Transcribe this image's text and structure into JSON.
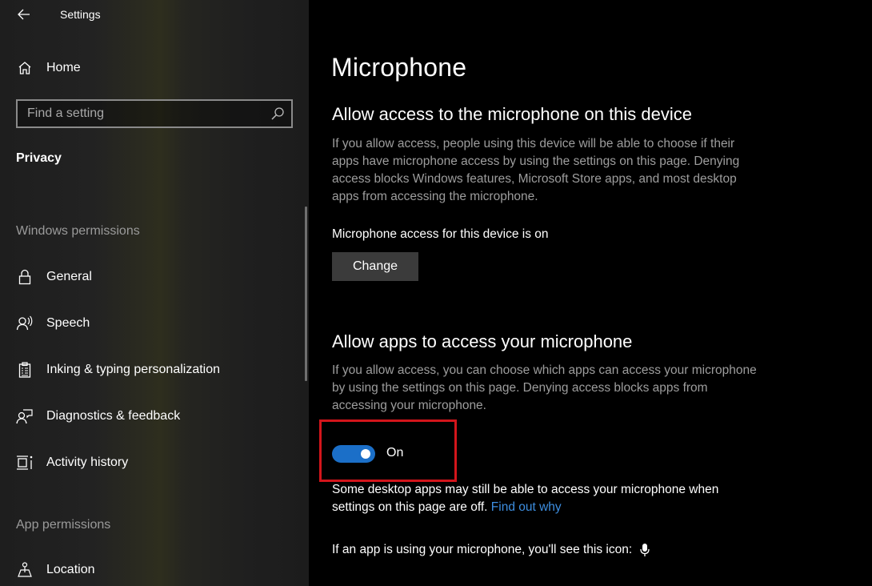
{
  "window": {
    "title": "Settings",
    "back_icon": "back-arrow-icon"
  },
  "sidebar": {
    "home": {
      "label": "Home",
      "icon": "home-icon"
    },
    "search": {
      "placeholder": "Find a setting",
      "value": "",
      "icon": "search-icon"
    },
    "current_section": "Privacy",
    "groups": [
      {
        "header": "Windows permissions",
        "items": [
          {
            "label": "General",
            "icon": "lock-icon"
          },
          {
            "label": "Speech",
            "icon": "speech-icon"
          },
          {
            "label": "Inking & typing personalization",
            "icon": "clipboard-icon"
          },
          {
            "label": "Diagnostics & feedback",
            "icon": "diagnostics-icon"
          },
          {
            "label": "Activity history",
            "icon": "activity-history-icon"
          }
        ]
      },
      {
        "header": "App permissions",
        "items": [
          {
            "label": "Location",
            "icon": "location-icon"
          }
        ]
      }
    ]
  },
  "main": {
    "page_title": "Microphone",
    "device_section": {
      "heading": "Allow access to the microphone on this device",
      "description": "If you allow access, people using this device will be able to choose if their apps have microphone access by using the settings on this page. Denying access blocks Windows features, Microsoft Store apps, and most desktop apps from accessing the microphone.",
      "status": "Microphone access for this device is on",
      "change_button": "Change"
    },
    "apps_section": {
      "heading": "Allow apps to access your microphone",
      "description": "If you allow access, you can choose which apps can access your microphone by using the settings on this page. Denying access blocks apps from accessing your microphone.",
      "toggle": {
        "state": true,
        "label": "On"
      },
      "note": "Some desktop apps may still be able to access your microphone when settings on this page are off.",
      "note_link": "Find out why",
      "icon_note": "If an app is using your microphone, you'll see this icon:",
      "icon_note_icon": "microphone-icon"
    }
  },
  "colors": {
    "accent": "#1b6fc8",
    "link": "#3d8ee0",
    "highlight": "#d3151b",
    "button_bg": "#3b3b3b",
    "secondary_text": "#9d9d9d"
  }
}
